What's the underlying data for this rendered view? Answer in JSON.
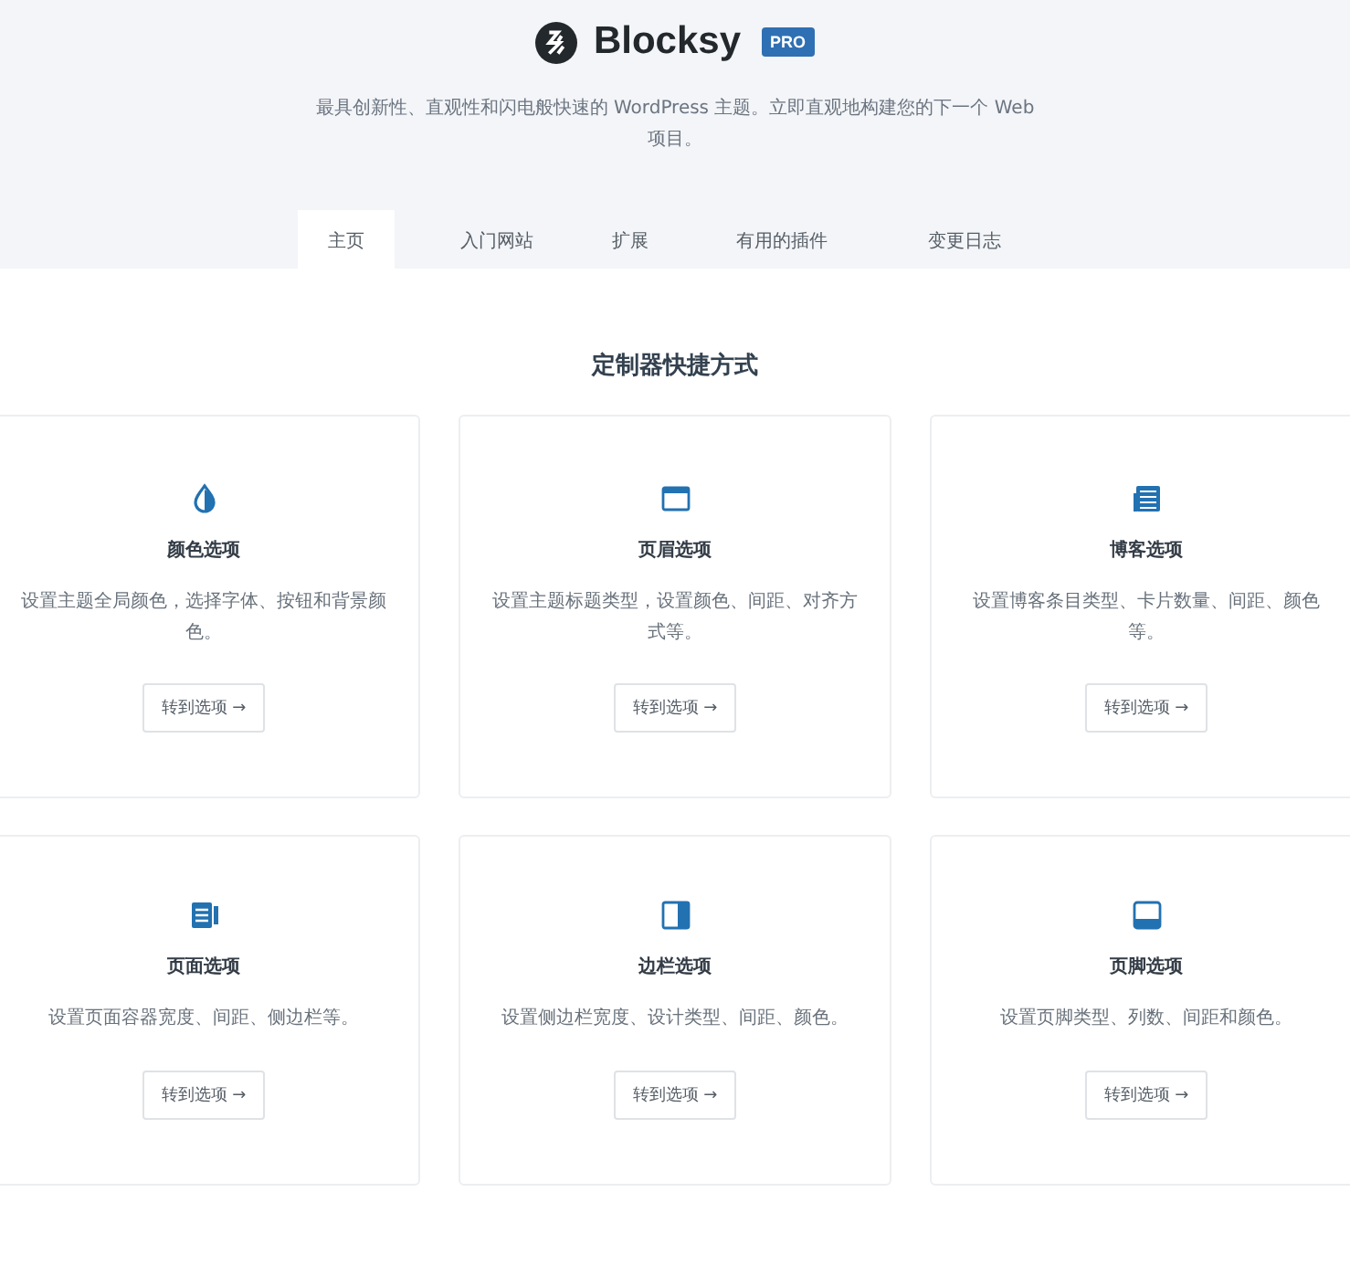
{
  "brand": {
    "name": "Blocksy",
    "badge": "PRO"
  },
  "tagline": "最具创新性、直观性和闪电般快速的 WordPress 主题。立即直观地构建您的下一个 Web 项目。",
  "tabs": [
    {
      "label": "主页",
      "selected": true
    },
    {
      "label": "入门网站",
      "selected": false
    },
    {
      "label": "扩展",
      "selected": false
    },
    {
      "label": "有用的插件",
      "selected": false
    },
    {
      "label": "变更日志",
      "selected": false
    }
  ],
  "section_title": "定制器快捷方式",
  "cards": [
    {
      "kind": "color",
      "title": "颜色选项",
      "text": "设置主题全局颜色，选择字体、按钮和背景颜色。",
      "button": "转到选项 →"
    },
    {
      "kind": "header",
      "title": "页眉选项",
      "text": "设置主题标题类型，设置颜色、间距、对齐方式等。",
      "button": "转到选项 →"
    },
    {
      "kind": "blog",
      "title": "博客选项",
      "text": "设置博客条目类型、卡片数量、间距、颜色等。",
      "button": "转到选项 →"
    },
    {
      "kind": "page",
      "title": "页面选项",
      "text": "设置页面容器宽度、间距、侧边栏等。",
      "button": "转到选项 →"
    },
    {
      "kind": "sidebar",
      "title": "边栏选项",
      "text": "设置侧边栏宽度、设计类型、间距、颜色。",
      "button": "转到选项 →"
    },
    {
      "kind": "footer",
      "title": "页脚选项",
      "text": "设置页脚类型、列数、间距和颜色。",
      "button": "转到选项 →"
    }
  ]
}
